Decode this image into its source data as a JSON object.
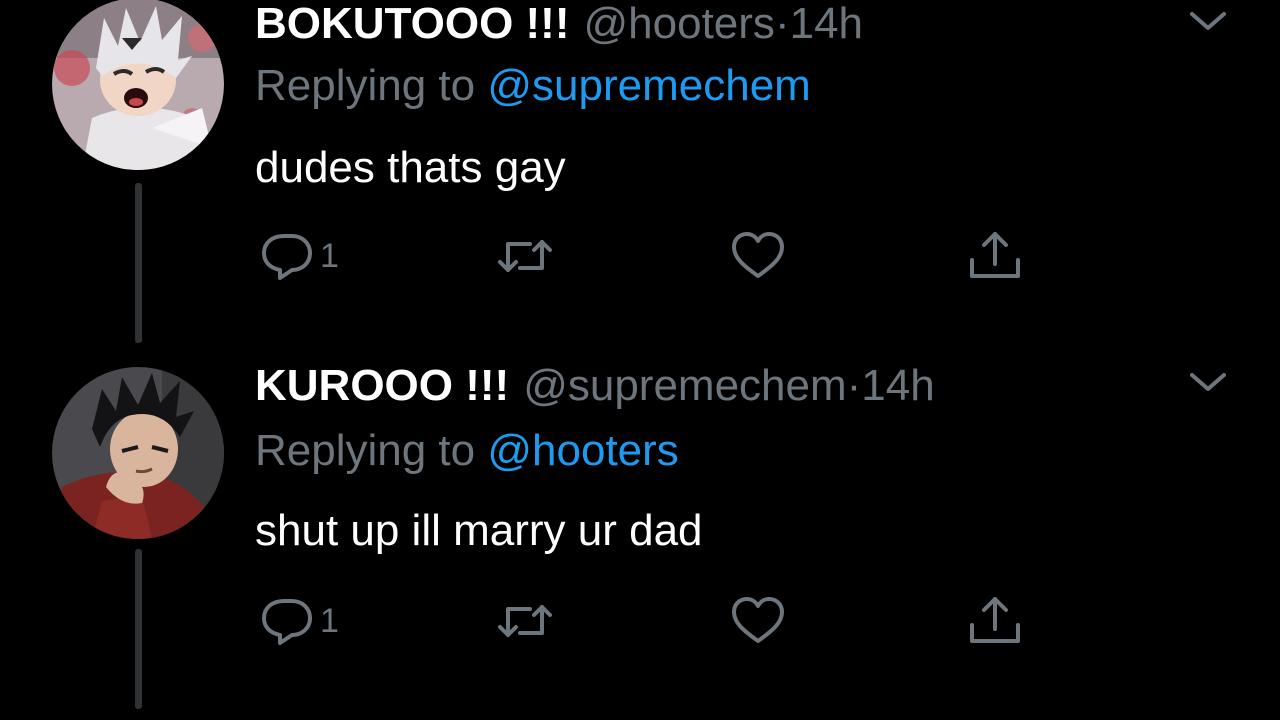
{
  "tweets": [
    {
      "display_name": "BOKUTOOO !!!",
      "handle": "@hooters",
      "separator": "·",
      "time": "14h",
      "replying_prefix": "Replying to",
      "replying_to": "@supremechem",
      "text": "dudes thats gay",
      "reply_count": "1",
      "avatar_icon": "avatar-bokuto"
    },
    {
      "display_name": "KUROOO !!!",
      "handle": "@supremechem",
      "separator": "·",
      "time": "14h",
      "replying_prefix": "Replying to",
      "replying_to": "@hooters",
      "text": "shut up ill marry ur dad",
      "reply_count": "1",
      "avatar_icon": "avatar-kuroo"
    }
  ],
  "icons": {
    "reply": "reply-icon",
    "retweet": "retweet-icon",
    "like": "like-icon",
    "share": "share-icon",
    "more": "chevron-down-icon"
  },
  "colors": {
    "background": "#000000",
    "primary_text": "#ffffff",
    "secondary_text": "#6e767d",
    "link": "#1d9bf0",
    "thread_line": "#2f3336"
  }
}
